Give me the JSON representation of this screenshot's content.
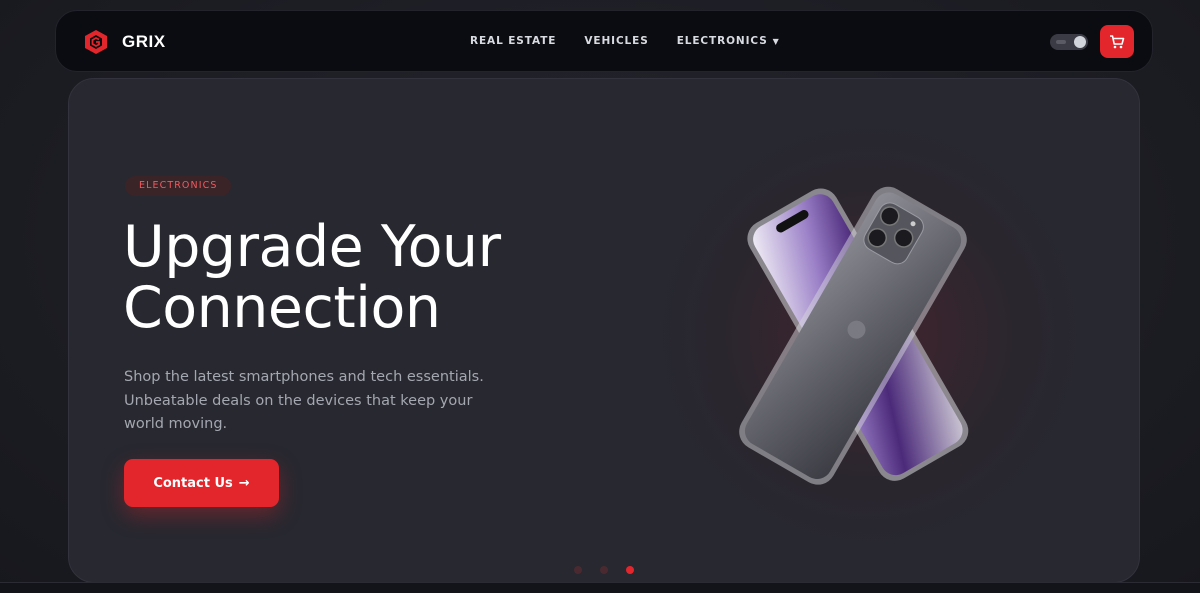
{
  "navbar": {
    "brand_name": "GRIX",
    "logo_icon": "grix-logo-icon",
    "links": [
      {
        "label": "REAL ESTATE"
      },
      {
        "label": "VEHICLES"
      },
      {
        "label": "ELECTRONICS",
        "has_dropdown": true
      }
    ],
    "theme_toggle_icon": "toggle-switch-icon",
    "cart_icon": "shopping-cart-icon"
  },
  "hero": {
    "badge": "ELECTRONICS",
    "headline": "Upgrade Your Connection",
    "description": "Shop the latest smartphones and tech essentials. Unbeatable deals on the devices that keep your world moving.",
    "cta_label": "Contact Us",
    "cta_arrow": "→",
    "image_icon": "smartphone-pair-image",
    "slides_count": 3,
    "active_slide": 3
  },
  "colors": {
    "accent": "#e3262b",
    "background": "#1e1f26",
    "card": "#272830",
    "navbar": "#0b0c11",
    "badge_text": "#f05a5e"
  }
}
